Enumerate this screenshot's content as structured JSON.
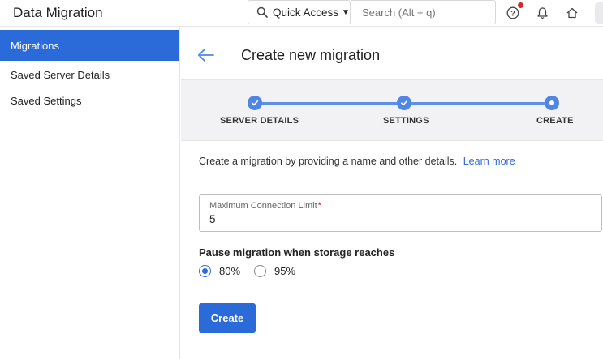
{
  "header": {
    "app_title": "Data Migration",
    "quick_access_label": "Quick Access",
    "search_placeholder": "Search (Alt + q)"
  },
  "sidebar": {
    "items": [
      {
        "label": "Migrations",
        "active": true
      },
      {
        "label": "Saved Server Details",
        "active": false
      },
      {
        "label": "Saved Settings",
        "active": false
      }
    ]
  },
  "main": {
    "title": "Create new migration",
    "stepper": {
      "steps": [
        {
          "label": "SERVER DETAILS",
          "state": "completed"
        },
        {
          "label": "SETTINGS",
          "state": "completed"
        },
        {
          "label": "CREATE",
          "state": "current"
        }
      ]
    },
    "description": "Create a migration by providing a name and other details.",
    "learn_more": "Learn more",
    "max_connection_field": {
      "label": "Maximum Connection Limit",
      "required_marker": "*",
      "value": "5"
    },
    "pause_section": {
      "label": "Pause migration when storage reaches",
      "options": [
        {
          "label": "80%",
          "selected": true
        },
        {
          "label": "95%",
          "selected": false
        }
      ]
    },
    "create_button": "Create"
  },
  "colors": {
    "accent": "#2a6ad9",
    "step": "#4f86e6",
    "stepper_bg": "#f2f2f5",
    "notification_dot": "#e0242f",
    "required": "#d9252f"
  },
  "icons": [
    "search-icon",
    "caret-down-icon",
    "help-icon",
    "bell-icon",
    "home-icon",
    "back-arrow-icon",
    "check-icon"
  ]
}
